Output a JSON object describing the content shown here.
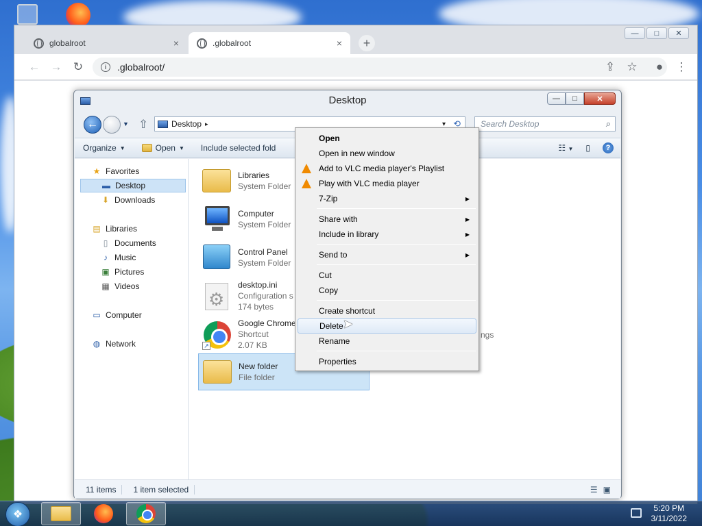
{
  "browser": {
    "tabs": [
      {
        "title": "globalroot",
        "close": "×"
      },
      {
        "title": ".globalroot",
        "close": "×"
      }
    ],
    "new_tab": "+",
    "address": ".globalroot/",
    "nav": {
      "back": "←",
      "forward": "→",
      "reload": "↻",
      "info": "i"
    },
    "window_controls": {
      "minimize": "—",
      "maximize": "□",
      "close": "✕"
    },
    "actions": {
      "share": "⇪",
      "bookmark": "☆",
      "profile": "●",
      "menu": "⋮"
    }
  },
  "explorer": {
    "title": "Desktop",
    "controls": {
      "minimize": "—",
      "maximize": "□",
      "close": "✕"
    },
    "address_segment": "Desktop",
    "address_arrow": "▸",
    "address_dropdown": "▾",
    "refresh": "⟲",
    "search_placeholder": "Search Desktop",
    "search_icon": "⌕",
    "commands": [
      {
        "label": "Organize",
        "caret": "▼"
      },
      {
        "label": "Open",
        "caret": "▼"
      },
      {
        "label": "Include selected fold",
        "caret": ""
      }
    ],
    "views_icon": "☷",
    "views_caret": "▼",
    "preview_icon": "▯",
    "help_icon": "?",
    "nav_pane": [
      {
        "label": "Favorites",
        "icon": "★"
      },
      {
        "label": "Desktop",
        "icon": "▬"
      },
      {
        "label": "Downloads",
        "icon": "⬇"
      },
      {
        "label": "Libraries",
        "icon": "▤"
      },
      {
        "label": "Documents",
        "icon": "▯"
      },
      {
        "label": "Music",
        "icon": "♪"
      },
      {
        "label": "Pictures",
        "icon": "▣"
      },
      {
        "label": "Videos",
        "icon": "▦"
      },
      {
        "label": "Computer",
        "icon": "▭"
      },
      {
        "label": "Network",
        "icon": "◍"
      }
    ],
    "files": [
      {
        "name": "Libraries",
        "sub": "System Folder",
        "sub2": ""
      },
      {
        "name": "Computer",
        "sub": "System Folder",
        "sub2": ""
      },
      {
        "name": "Control Panel",
        "sub": "System Folder",
        "sub2": ""
      },
      {
        "name": "desktop.ini",
        "sub": "Configuration s",
        "sub2": "174 bytes"
      },
      {
        "name": "Google Chrome",
        "sub": "Shortcut",
        "sub2": "2.07 KB"
      },
      {
        "name": "New folder",
        "sub": "File folder",
        "sub2": ""
      }
    ],
    "shortcut_arrow": "↗",
    "partial_right_text": "ngs",
    "status": {
      "items": "11 items",
      "selected": "1 item selected"
    },
    "view_icons": [
      "☰",
      "▣"
    ]
  },
  "context_menu": {
    "items": [
      {
        "label": "Open",
        "arrow": ""
      },
      {
        "label": "Open in new window",
        "arrow": ""
      },
      {
        "label": "Add to VLC media player's Playlist",
        "arrow": ""
      },
      {
        "label": "Play with VLC media player",
        "arrow": ""
      },
      {
        "label": "7-Zip",
        "arrow": "▶"
      },
      {
        "label": "Share with",
        "arrow": "▶"
      },
      {
        "label": "Include in library",
        "arrow": "▶"
      },
      {
        "label": "Send to",
        "arrow": "▶"
      },
      {
        "label": "Cut",
        "arrow": ""
      },
      {
        "label": "Copy",
        "arrow": ""
      },
      {
        "label": "Create shortcut",
        "arrow": ""
      },
      {
        "label": "Delete",
        "arrow": ""
      },
      {
        "label": "Rename",
        "arrow": ""
      },
      {
        "label": "Properties",
        "arrow": ""
      }
    ],
    "hovered": "Delete"
  },
  "taskbar": {
    "start": "❖",
    "time": "5:20 PM",
    "date": "3/11/2022"
  }
}
